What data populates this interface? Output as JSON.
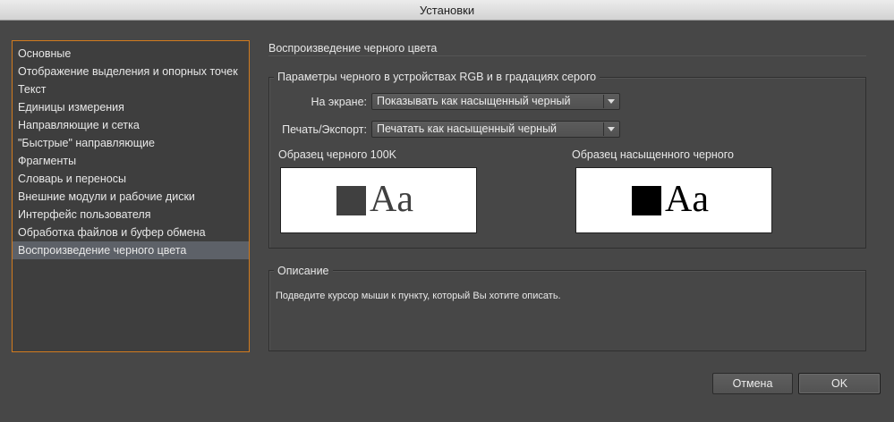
{
  "window": {
    "title": "Установки"
  },
  "sidebar": {
    "items": [
      {
        "label": "Основные"
      },
      {
        "label": "Отображение выделения и опорных точек"
      },
      {
        "label": "Текст"
      },
      {
        "label": "Единицы измерения"
      },
      {
        "label": "Направляющие и сетка"
      },
      {
        "label": "\"Быстрые\" направляющие"
      },
      {
        "label": "Фрагменты"
      },
      {
        "label": "Словарь и переносы"
      },
      {
        "label": "Внешние модули и рабочие диски"
      },
      {
        "label": "Интерфейс пользователя"
      },
      {
        "label": "Обработка файлов и буфер обмена"
      },
      {
        "label": "Воспроизведение черного цвета"
      }
    ],
    "selected_index": 11
  },
  "main": {
    "section_title": "Воспроизведение черного цвета",
    "options_group": {
      "legend": "Параметры черного в устройствах RGB и в градациях серого",
      "on_screen": {
        "label": "На экране:",
        "value": "Показывать как насыщенный черный"
      },
      "print_export": {
        "label": "Печать/Экспорт:",
        "value": "Печатать как насыщенный черный"
      },
      "sample_100k": {
        "label": "Образец черного 100K",
        "text": "Aa",
        "swatch_color": "#404040",
        "text_color": "#404040"
      },
      "sample_rich": {
        "label": "Образец насыщенного черного",
        "text": "Aa",
        "swatch_color": "#000000",
        "text_color": "#000000"
      }
    },
    "description_group": {
      "legend": "Описание",
      "text": "Подведите курсор мыши к пункту, который Вы хотите описать."
    }
  },
  "buttons": {
    "cancel": "Отмена",
    "ok": "OK"
  },
  "colors": {
    "accent": "#d27b1e",
    "background": "#474747",
    "selection": "#5d6168"
  }
}
